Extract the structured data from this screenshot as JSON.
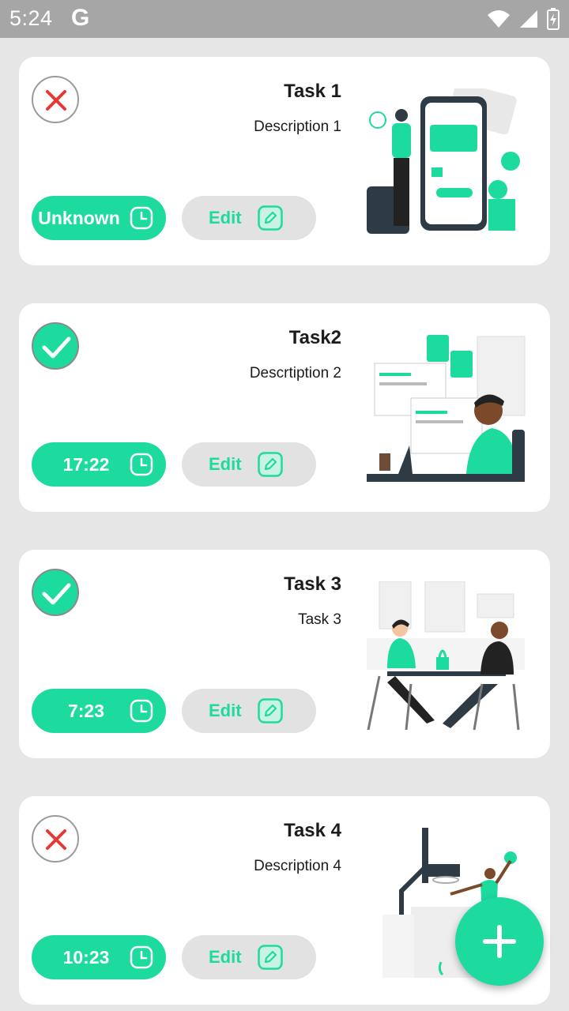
{
  "status_bar": {
    "time": "5:24",
    "g_label": "G"
  },
  "tasks": [
    {
      "status": "fail",
      "title": "Task 1",
      "description": "Description 1",
      "time": "Unknown",
      "edit_label": "Edit",
      "illustration": "mobile-payment-illustration"
    },
    {
      "status": "done",
      "title": "Task2",
      "description": "Descrtiption 2",
      "time": "17:22",
      "edit_label": "Edit",
      "illustration": "coding-developer-illustration"
    },
    {
      "status": "done",
      "title": "Task 3",
      "description": "Task 3",
      "time": "7:23",
      "edit_label": "Edit",
      "illustration": "coffee-meeting-illustration"
    },
    {
      "status": "fail",
      "title": "Task 4",
      "description": "Description 4",
      "time": "10:23",
      "edit_label": "Edit",
      "illustration": "basketball-illustration"
    }
  ],
  "fab": {
    "icon": "plus-icon"
  },
  "colors": {
    "accent": "#1ddb9f",
    "fail_red": "#e53935",
    "edit_bg": "#e2e2e2",
    "background": "#e6e6e6"
  }
}
